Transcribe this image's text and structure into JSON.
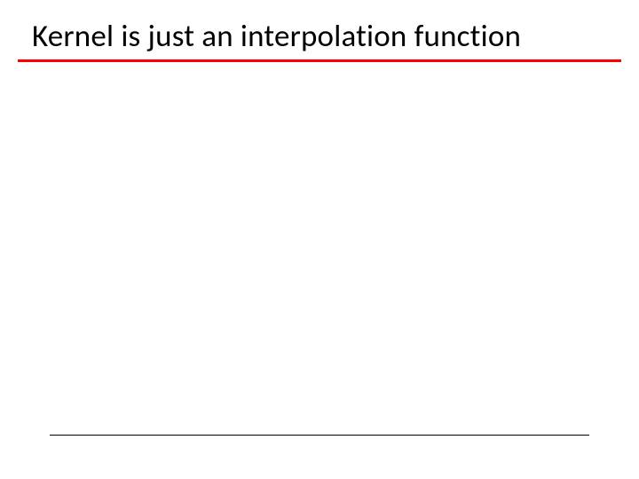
{
  "slide": {
    "title": "Kernel is just an interpolation function"
  }
}
